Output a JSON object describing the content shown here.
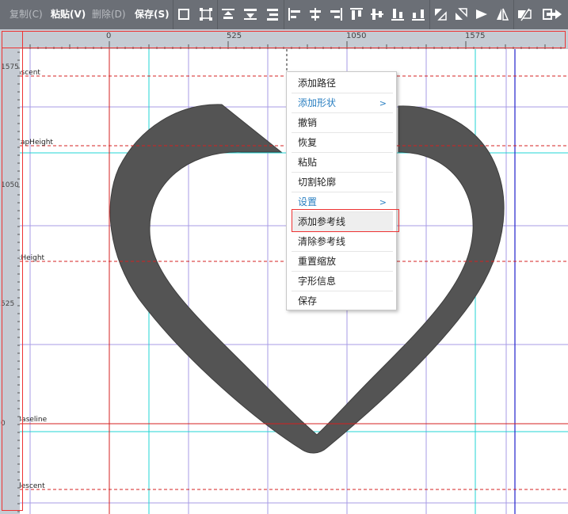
{
  "toolbar": {
    "copy_label": "复制(C)",
    "paste_label": "粘贴(V)",
    "delete_label": "删除(D)",
    "save_label": "保存(S)",
    "icons": [
      "select-rect-icon",
      "transform-icon",
      "align-top-icon",
      "align-vmiddle-icon",
      "align-bottom-icon",
      "align-left-icon",
      "align-hcenter-icon",
      "align-right-icon",
      "dist-top-icon",
      "dist-vcenter-icon",
      "dist-bottom-icon",
      "flip-horizontal-icon",
      "flip-vertical-icon",
      "mirror-h-icon",
      "mirror-v-icon",
      "toggle-contour-icon",
      "exit-icon"
    ]
  },
  "ruler": {
    "top_labels": [
      "0",
      "525",
      "1050",
      "1575"
    ],
    "left_labels": [
      "1575",
      "1050",
      "525",
      "0"
    ]
  },
  "metrics": {
    "ascent": "ascent",
    "capHeight": "capHeight",
    "xHeight": "xHeight",
    "baseline": "Baseline",
    "descent": "descent"
  },
  "context_menu": {
    "items": [
      {
        "label": "添加路径",
        "submenu": false
      },
      {
        "label": "添加形状",
        "submenu": true
      },
      {
        "label": "撤销",
        "submenu": false
      },
      {
        "label": "恢复",
        "submenu": false
      },
      {
        "label": "粘贴",
        "submenu": false
      },
      {
        "label": "切割轮廓",
        "submenu": false
      },
      {
        "label": "设置",
        "submenu": true
      },
      {
        "label": "添加参考线",
        "submenu": false
      },
      {
        "label": "清除参考线",
        "submenu": false
      },
      {
        "label": "重置缩放",
        "submenu": false
      },
      {
        "label": "字形信息",
        "submenu": false
      },
      {
        "label": "保存",
        "submenu": false
      }
    ],
    "highlighted": "添加参考线",
    "arrow": ">"
  },
  "colors": {
    "toolbar_bg": "#6b6f76",
    "ruler_bg": "#c5cbd3",
    "glyph_fill": "#545454",
    "guide_cyan": "#22d4d4",
    "grid_purple": "#a79be6",
    "metric_red": "#d42020",
    "highlight_border": "#e33333",
    "submenu_blue": "#2a7fc1"
  }
}
